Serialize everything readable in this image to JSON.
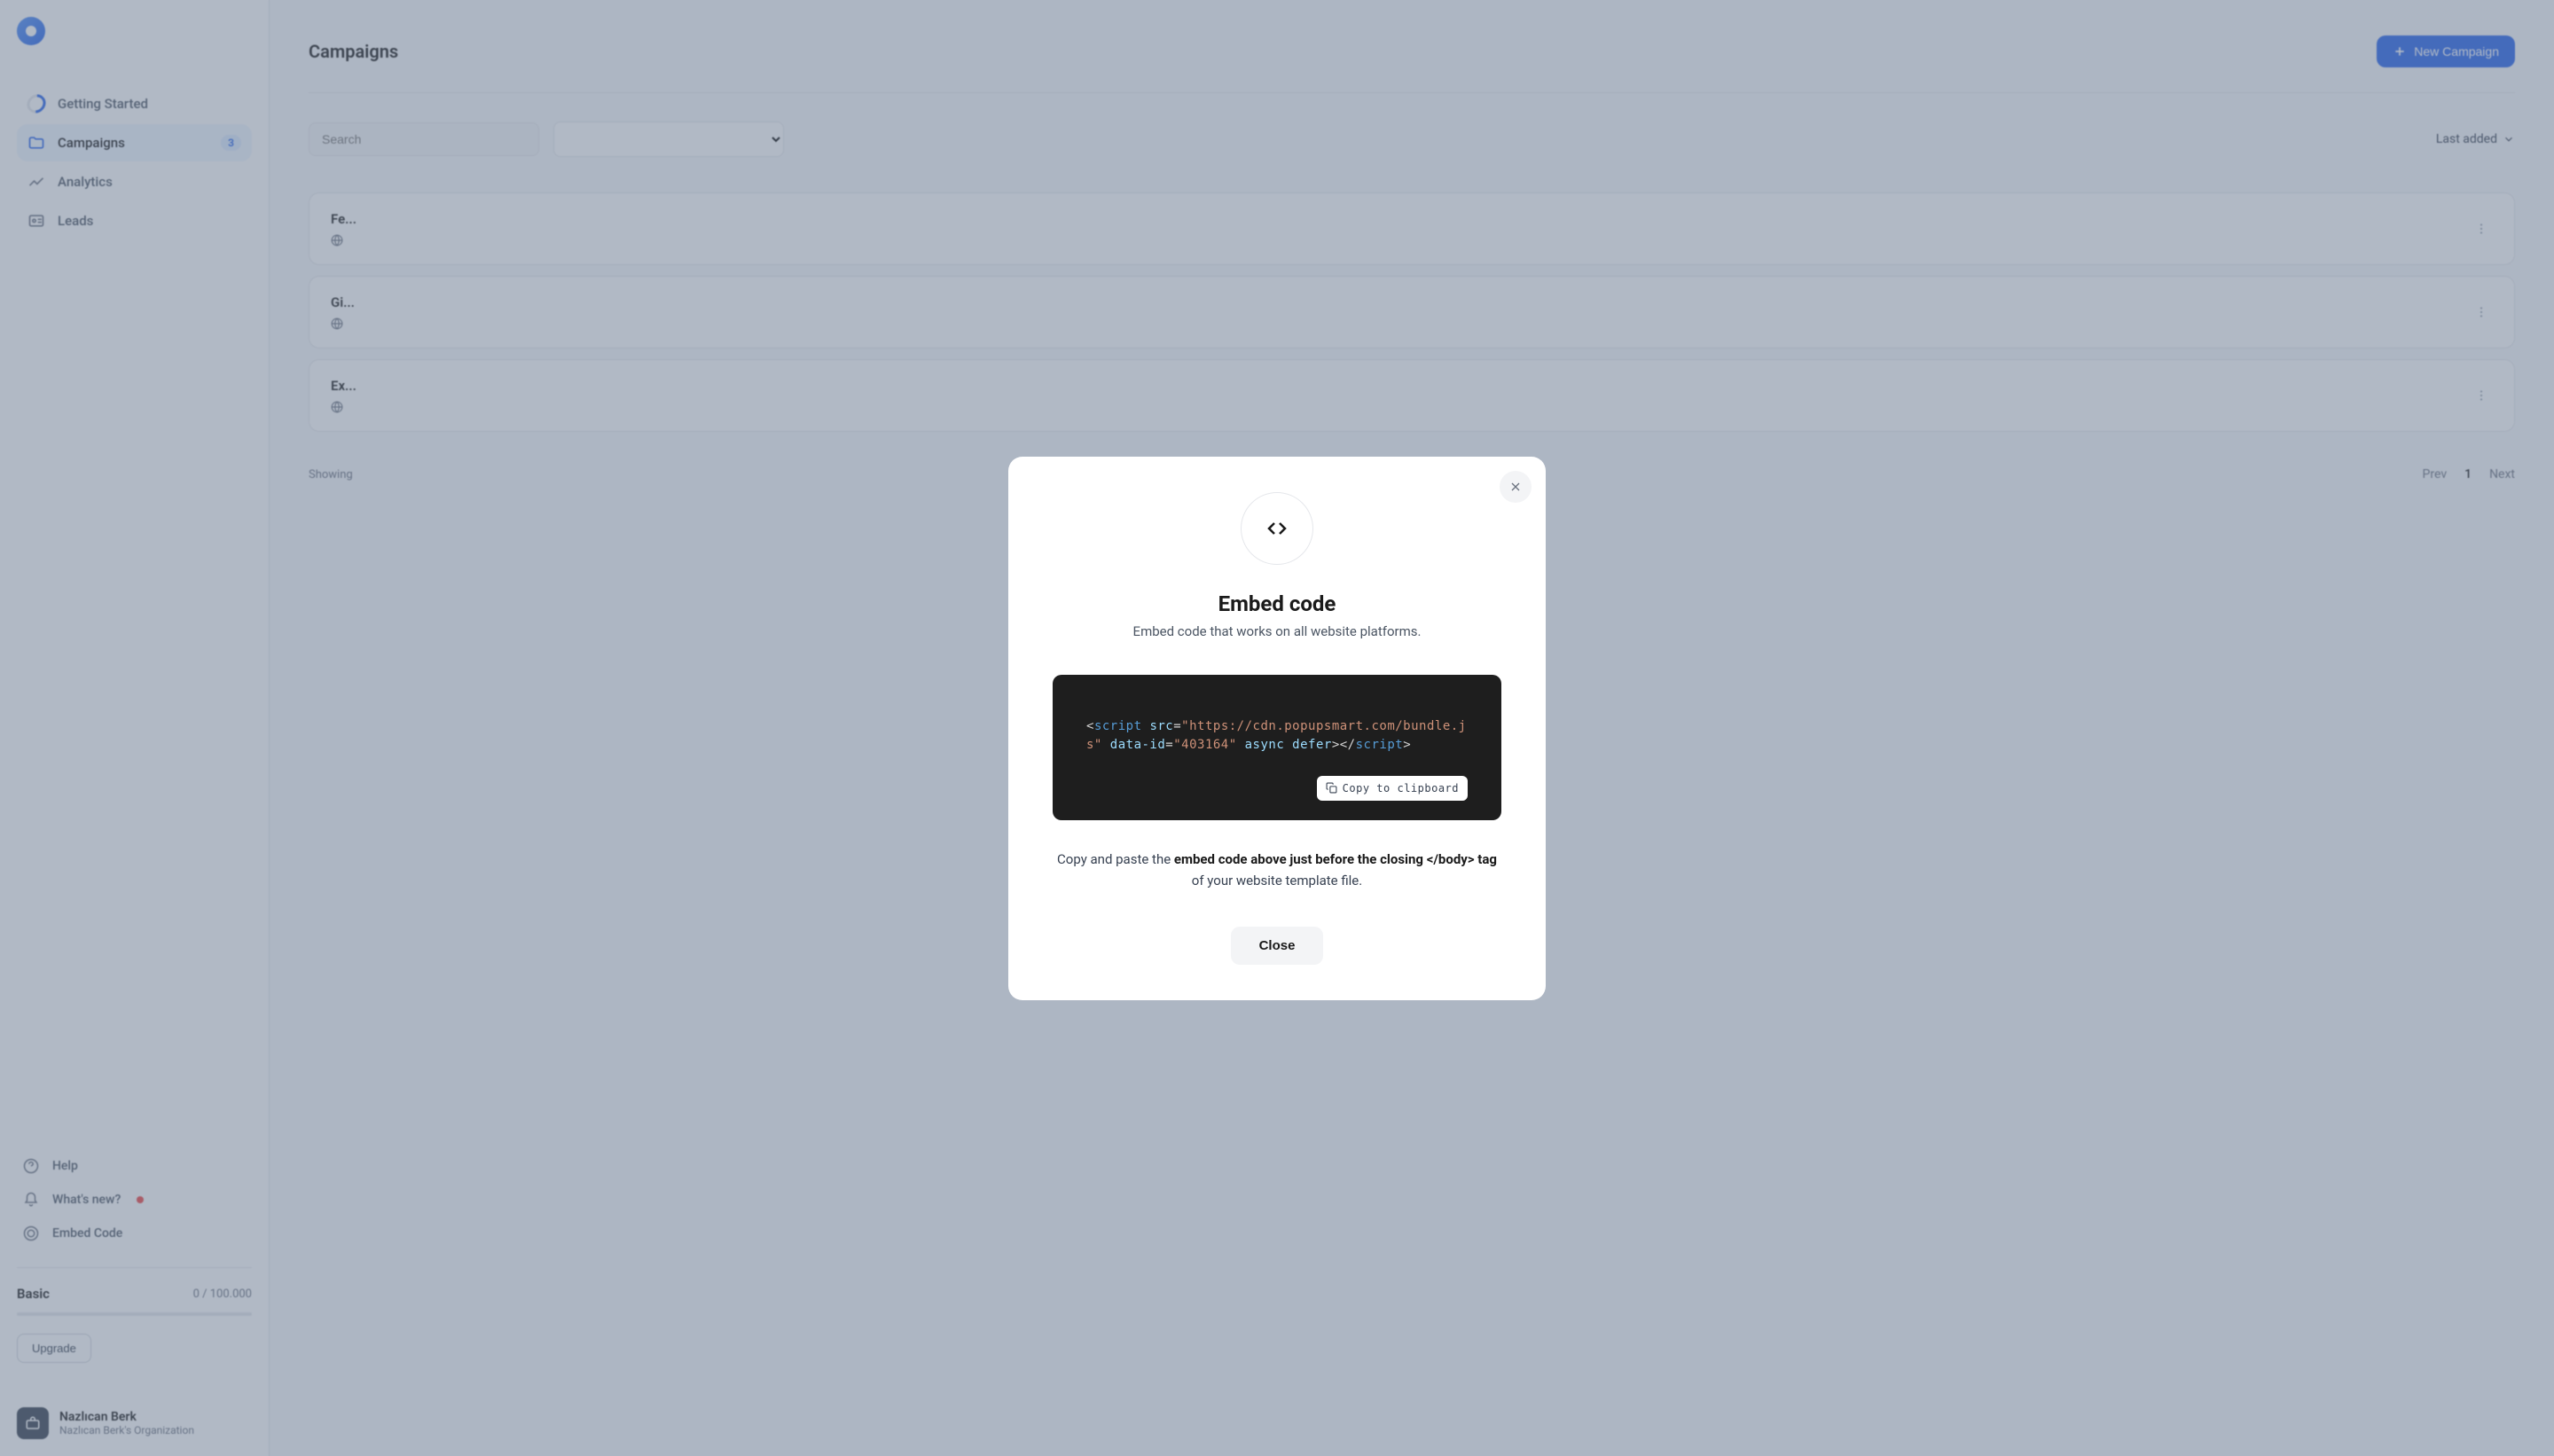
{
  "sidebar": {
    "nav": {
      "getting_started": "Getting Started",
      "campaigns": "Campaigns",
      "campaigns_badge": "3",
      "analytics": "Analytics",
      "leads": "Leads"
    },
    "bottom": {
      "help": "Help",
      "whats_new": "What's new?",
      "embed_code": "Embed Code"
    },
    "plan": {
      "name": "Basic",
      "usage": "0 / 100.000",
      "upgrade": "Upgrade"
    },
    "user": {
      "name": "Nazlıcan Berk",
      "org": "Nazlıcan Berk's Organization"
    }
  },
  "main": {
    "title": "Campaigns",
    "new_button": "New Campaign",
    "search_placeholder": "Search",
    "sort_label": "Last added",
    "pagination": {
      "showing": "Showing",
      "prev": "Prev",
      "current": "1",
      "next": "Next"
    }
  },
  "modal": {
    "title": "Embed code",
    "subtitle": "Embed code that works on all website platforms.",
    "code": {
      "lt": "<",
      "script_open": "script",
      "src_attr": " src",
      "equals1": "=",
      "src_value": "\"https://cdn.popupsmart.com/bundle.js\"",
      "data_id_attr": " data-id",
      "equals2": "=",
      "data_id_value": "\"403164\"",
      "async_defer": " async defer",
      "gt_close_open": "></",
      "script_close": "script",
      "gt": ">"
    },
    "copy_button": "Copy to clipboard",
    "instruction_1": "Copy and paste the ",
    "instruction_bold": "embed code above just before the closing </body> tag",
    "instruction_2": " of your website template file.",
    "close_button": "Close"
  }
}
